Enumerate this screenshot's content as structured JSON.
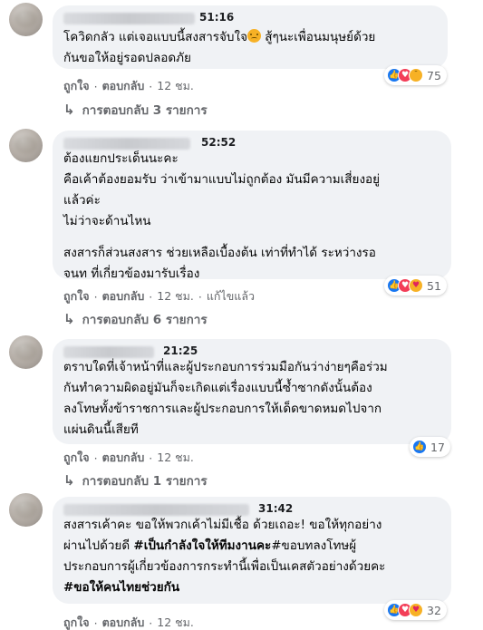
{
  "comments": [
    {
      "time": "51:16",
      "text_a": "โควิดกลัว แต่เจอแบบนี้สงสารจับใจ",
      "text_b": " สู้ๆนะเพื่อนมนุษย์ด้วย\nกันขอให้อยู่รอดปลอดภัย",
      "emoji_icon": "sad-face",
      "reaction_count": "75",
      "reaction_icons": [
        "like",
        "love",
        "sad"
      ],
      "actions": {
        "like": "ถูกใจ",
        "reply": "ตอบกลับ",
        "age": "12 ชม."
      },
      "replies_label": "การตอบกลับ 3 รายการ"
    },
    {
      "time": "52:52",
      "text_1": "ต้องแยกประเด็นนะคะ\nคือเค้าต้องยอมรับ ว่าเข้ามาแบบไม่ถูกต้อง มันมีความเสี่ยงอยู่\nแล้วค่ะ\nไม่ว่าจะด้านไหน",
      "text_2": "สงสารก็ส่วนสงสาร ช่วยเหลือเบื้องต้น เท่าที่ทำได้ ระหว่างรอ\nจนท ที่เกี่ยวข้องมารับเรื่อง",
      "reaction_count": "51",
      "reaction_icons": [
        "like",
        "love",
        "care"
      ],
      "actions": {
        "like": "ถูกใจ",
        "reply": "ตอบกลับ",
        "age": "12 ชม.",
        "edited": "แก้ไขแล้ว"
      },
      "replies_label": "การตอบกลับ 6 รายการ"
    },
    {
      "time": "21:25",
      "text": "ตราบใดที่เจ้าหน้าที่และผู้ประกอบการร่วมมือกันว่าง่ายๆคือร่วม\nกันทำความผิดอยู่มันก็จะเกิดแต่เรื่องแบบนี้ซ้ำซากดังนั้นต้อง\nลงโทษทั้งข้าราชการและผู้ประกอบการให้เด็ดขาดหมดไปจาก\nแผ่นดินนี้เสียที",
      "reaction_count": "17",
      "reaction_icons": [
        "like"
      ],
      "actions": {
        "like": "ถูกใจ",
        "reply": "ตอบกลับ",
        "age": "12 ชม."
      },
      "replies_label": "การตอบกลับ 1 รายการ"
    },
    {
      "time": "31:42",
      "text_a": "สงสารเค้าคะ ขอให้พวกเค้าไม่มีเชื้อ ด้วยเถอะ! ขอให้ทุกอย่าง\nผ่านไปด้วยดี ",
      "tag_1": "#เป็นกำลังใจให้ทีมงานคะ",
      "text_b": "#ขอบทลงโทษผู้\nประกอบการผู้เกี่ยวข้องการกระทำนี้เพื่อเป็นเคสตัวอย่างด้วยคะ\n",
      "tag_2": "#ขอให้คนไทยช่วยกัน",
      "reaction_count": "32",
      "reaction_icons": [
        "like",
        "love",
        "care"
      ],
      "actions": {
        "like": "ถูกใจ",
        "reply": "ตอบกลับ",
        "age": "12 ชม."
      }
    }
  ]
}
